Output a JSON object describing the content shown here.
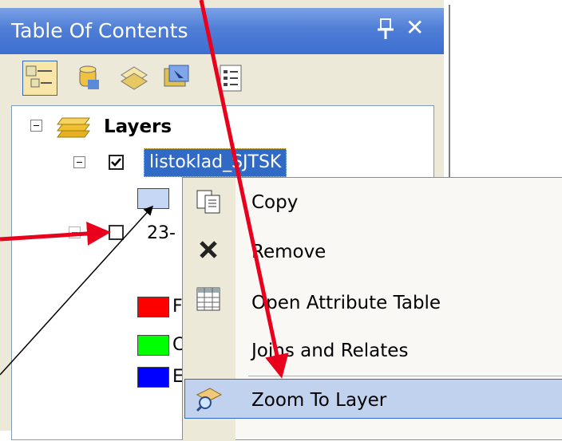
{
  "panel": {
    "title": "Table Of Contents",
    "pin_glyph": "pin-icon",
    "close_glyph": "✕"
  },
  "toolbar": {
    "buttons": [
      "list-by-drawing-order",
      "list-by-source",
      "list-by-visibility",
      "list-by-selection",
      "options"
    ]
  },
  "tree": {
    "root_label": "Layers",
    "layer1": {
      "label": "listoklad_SJTSK",
      "checked": true
    },
    "layer2": {
      "label": "23-",
      "checked": false
    },
    "legend_swatches": [
      {
        "color": "#c6d7f5",
        "letter": ""
      },
      {
        "color": "#ff0000",
        "letter": "F"
      },
      {
        "color": "#00ff00",
        "letter": "C"
      },
      {
        "color": "#0000ff",
        "letter": "E"
      }
    ]
  },
  "context_menu": {
    "items": [
      {
        "label": "Copy",
        "icon": "copy-icon"
      },
      {
        "label": "Remove",
        "icon": "remove-icon"
      },
      {
        "label": "Open Attribute Table",
        "icon": "table-icon"
      },
      {
        "label": "Joins and Relates",
        "icon": ""
      },
      {
        "label": "Zoom To Layer",
        "icon": "zoom-to-layer-icon",
        "highlighted": true
      }
    ]
  },
  "colors": {
    "title_bar": "#3c6fd1",
    "selection": "#316ac5",
    "arrow": "#e8001c"
  }
}
